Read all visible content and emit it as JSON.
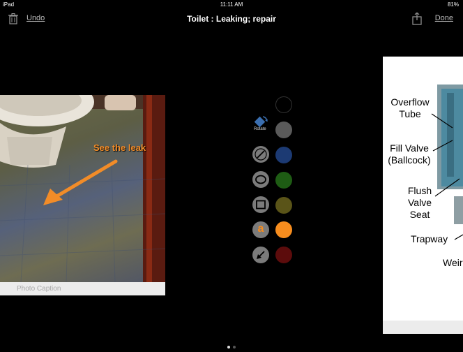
{
  "status": {
    "device": "iPad",
    "time": "11:11 AM",
    "battery": "81%"
  },
  "nav": {
    "undo": "Undo",
    "title": "Toilet : Leaking; repair",
    "done": "Done"
  },
  "left_photo": {
    "annotation": "See the leak",
    "caption_placeholder": "Photo Caption"
  },
  "right_photo": {
    "labels": [
      "Overflow Tube",
      "Fill Valve (Ballcock)",
      "Flush Valve Seat",
      "Trapway",
      "Weir"
    ]
  },
  "tools": {
    "rotate_label": "Rotate",
    "text_tool_glyph": "a"
  },
  "colors": {
    "black": "#000000",
    "gray": "#5a5a5a",
    "navy": "#1c3a73",
    "green": "#1e5c14",
    "olive": "#5a5418",
    "orange": "#f78d1e",
    "maroon": "#5c0c0c",
    "accent_orange": "#f28c28"
  },
  "pager": {
    "pages": 2,
    "current": 1
  }
}
